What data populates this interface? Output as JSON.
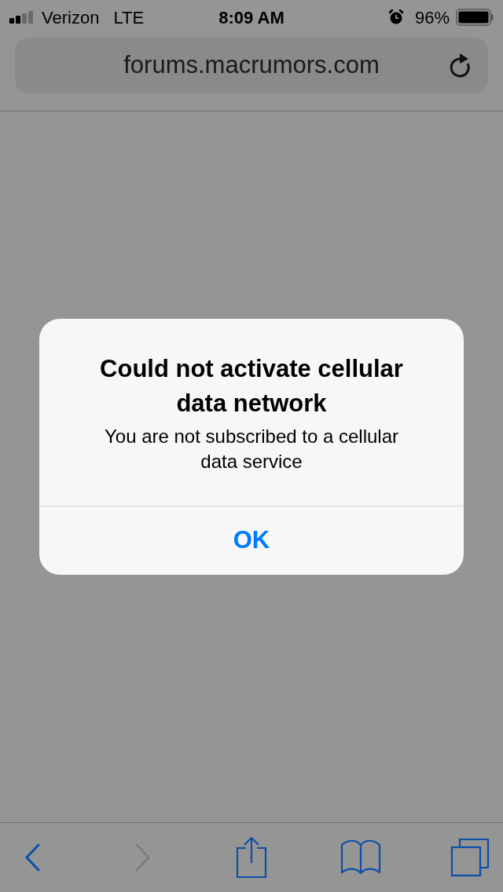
{
  "status_bar": {
    "carrier": "Verizon",
    "network": "LTE",
    "time": "8:09 AM",
    "battery": "96%"
  },
  "address_bar": {
    "url": "forums.macrumors.com"
  },
  "alert": {
    "title": "Could not activate cellular data network",
    "message": "You are not subscribed to a cellular data service",
    "buttons": [
      "OK"
    ]
  },
  "toolbar": {
    "back": {
      "disabled": false
    },
    "forward": {
      "disabled": true
    }
  }
}
